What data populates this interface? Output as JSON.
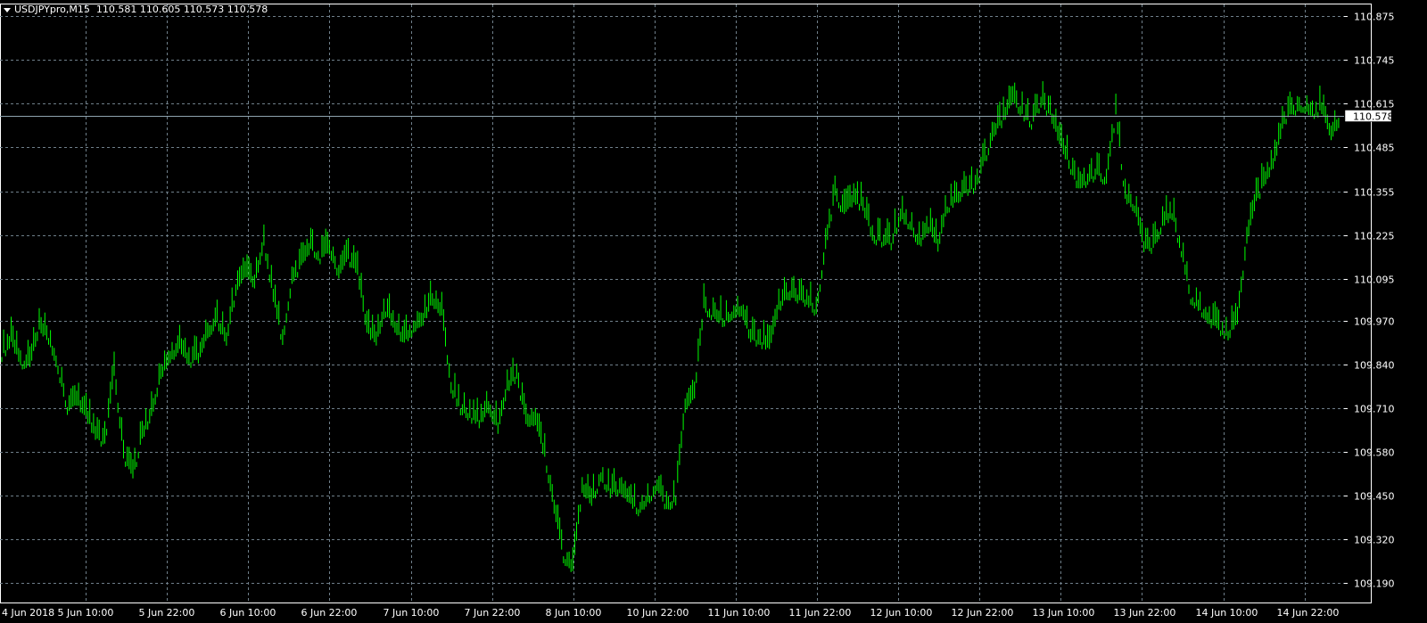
{
  "header": {
    "symbol": "USDJPYpro,M15",
    "ohlc": "110.581 110.605 110.573 110.578"
  },
  "colors": {
    "background": "#000000",
    "bars": "#00ff00",
    "grid": "#6f7f8a",
    "price_line": "#8fa3ae"
  },
  "current_price_label": "110.578",
  "chart_data": {
    "type": "bar",
    "series": [
      {
        "name": "",
        "y": [
          109.88,
          109.92,
          109.86,
          109.85,
          109.96,
          109.93,
          109.84,
          109.72,
          109.74,
          109.7,
          109.64,
          109.62,
          109.82,
          109.58,
          109.52,
          109.64,
          109.7,
          109.82,
          109.87,
          109.9,
          109.86,
          109.87,
          109.94,
          109.98,
          109.92,
          110.07,
          110.12,
          110.09,
          110.21,
          110.05,
          109.92,
          110.1,
          110.15,
          110.2,
          110.17,
          110.19,
          110.12,
          110.17,
          110.12,
          109.95,
          109.92,
          110.01,
          109.96,
          109.92,
          109.96,
          109.98,
          110.04,
          110.0,
          109.78,
          109.72,
          109.7,
          109.68,
          109.72,
          109.66,
          109.78,
          109.82,
          109.68,
          109.68,
          109.58,
          109.42,
          109.28,
          109.24,
          109.48,
          109.44,
          109.52,
          109.47,
          109.48,
          109.45,
          109.42,
          109.45,
          109.49,
          109.43,
          109.45,
          109.72,
          109.76,
          110.02,
          110.0,
          109.98,
          110.0,
          110.01,
          109.93,
          109.92,
          109.9,
          110.02,
          110.06,
          110.05,
          110.04,
          110.01,
          110.2,
          110.36,
          110.3,
          110.34,
          110.32,
          110.23,
          110.22,
          110.21,
          110.29,
          110.27,
          110.21,
          110.26,
          110.2,
          110.32,
          110.34,
          110.37,
          110.38,
          110.46,
          110.54,
          110.58,
          110.64,
          110.6,
          110.57,
          110.63,
          110.6,
          110.51,
          110.45,
          110.38,
          110.4,
          110.42,
          110.4,
          110.6,
          110.35,
          110.32,
          110.2,
          110.2,
          110.27,
          110.3,
          110.19,
          110.05,
          110.02,
          109.98,
          109.96,
          109.94,
          109.98,
          110.22,
          110.34,
          110.4,
          110.46,
          110.58,
          110.61,
          110.62,
          110.6,
          110.61,
          110.53,
          110.58
        ]
      }
    ],
    "x_tick_labels": [
      "4 Jun 2018",
      "5 Jun 10:00",
      "5 Jun 22:00",
      "6 Jun 10:00",
      "6 Jun 22:00",
      "7 Jun 10:00",
      "7 Jun 22:00",
      "8 Jun 10:00",
      "10 Jun 22:00",
      "11 Jun 10:00",
      "11 Jun 22:00",
      "12 Jun 10:00",
      "12 Jun 22:00",
      "13 Jun 10:00",
      "13 Jun 22:00",
      "14 Jun 10:00",
      "14 Jun 22:00"
    ],
    "y_tick_labels": [
      "110.875",
      "110.745",
      "110.615",
      "110.485",
      "110.355",
      "110.225",
      "110.095",
      "109.970",
      "109.840",
      "109.710",
      "109.580",
      "109.450",
      "109.320",
      "109.190"
    ],
    "ylim": [
      109.17,
      110.91
    ],
    "current_price": 110.578,
    "grid": true
  }
}
